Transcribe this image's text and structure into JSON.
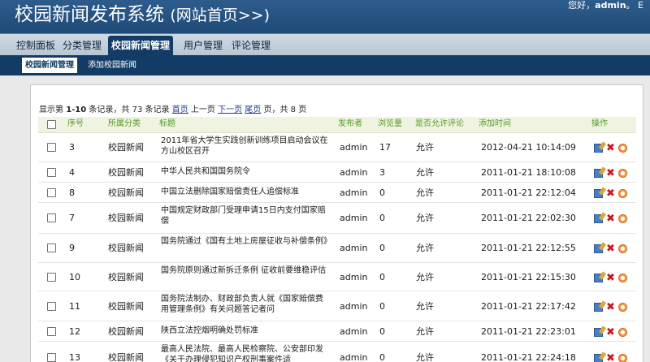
{
  "header": {
    "title": "校园新闻发布系统",
    "home_link": "(网站首页>>)",
    "greeting": "您好，",
    "username": "admin",
    "username_suffix": "。 E"
  },
  "mainnav": {
    "items": [
      "控制面板",
      "分类管理",
      "校园新闻管理",
      "用户管理",
      "评论管理"
    ],
    "active_index": 2
  },
  "subnav": {
    "items": [
      "校园新闻管理",
      "添加校园新闻"
    ],
    "active_index": 0
  },
  "pager": {
    "prefix": "显示第",
    "range": "1-10",
    "records_mid": "条记录，共",
    "total": "73",
    "records_suffix": "条记录",
    "first": "首页",
    "prev": "上一页",
    "next": "下一页",
    "last": "尾页",
    "pages_label": "页，共",
    "pages_total": "8",
    "pages_suffix": "页"
  },
  "table": {
    "columns": [
      "序号",
      "所属分类",
      "标题",
      "发布者",
      "浏览量",
      "是否允许评论",
      "添加时间",
      "操作"
    ],
    "rows": [
      {
        "id": "3",
        "category": "校园新闻",
        "title": "2011年省大学生实践创新训练项目启动会议在方山校区召开",
        "author": "admin",
        "views": "17",
        "allow": "允许",
        "time": "2012-04-21 10:14:09"
      },
      {
        "id": "4",
        "category": "校园新闻",
        "title": "中华人民共和国国务院令",
        "author": "admin",
        "views": "3",
        "allow": "允许",
        "time": "2011-01-21 18:10:08"
      },
      {
        "id": "8",
        "category": "校园新闻",
        "title": "中国立法删除国家赔偿责任人追偿标准",
        "author": "admin",
        "views": "0",
        "allow": "允许",
        "time": "2011-01-21 22:12:04"
      },
      {
        "id": "7",
        "category": "校园新闻",
        "title": "中国规定财政部门受理申请15日内支付国家赔偿",
        "author": "admin",
        "views": "0",
        "allow": "允许",
        "time": "2011-01-21 22:02:30"
      },
      {
        "id": "9",
        "category": "校园新闻",
        "title": "国务院通过《国有土地上房屋征收与补偿条例》",
        "author": "admin",
        "views": "0",
        "allow": "允许",
        "time": "2011-01-21 22:12:55"
      },
      {
        "id": "10",
        "category": "校园新闻",
        "title": "国务院原则通过新拆迁条例 征收前要维稳评估",
        "author": "admin",
        "views": "0",
        "allow": "允许",
        "time": "2011-01-21 22:15:30"
      },
      {
        "id": "11",
        "category": "校园新闻",
        "title": "国务院法制办、财政部负责人就《国家赔偿费用管理条例》有关问题答记者问",
        "author": "admin",
        "views": "0",
        "allow": "允许",
        "time": "2011-01-21 22:17:42"
      },
      {
        "id": "12",
        "category": "校园新闻",
        "title": "陕西立法控烟明确处罚标准",
        "author": "admin",
        "views": "0",
        "allow": "允许",
        "time": "2011-01-21 22:23:01"
      },
      {
        "id": "13",
        "category": "校园新闻",
        "title": "最高人民法院、最高人民检察院、公安部印发《关于办理侵犯知识产权刑事案件适",
        "author": "admin",
        "views": "0",
        "allow": "允许",
        "time": "2011-01-21 22:24:18"
      }
    ]
  },
  "icons": {
    "edit": "edit-icon",
    "delete": "delete-icon",
    "view": "view-icon"
  },
  "colors": {
    "header_bg": "#2d5c8c",
    "subnav_bg": "#123c65",
    "column_header_text": "#5a9a23",
    "delete_red": "#c4161c"
  }
}
